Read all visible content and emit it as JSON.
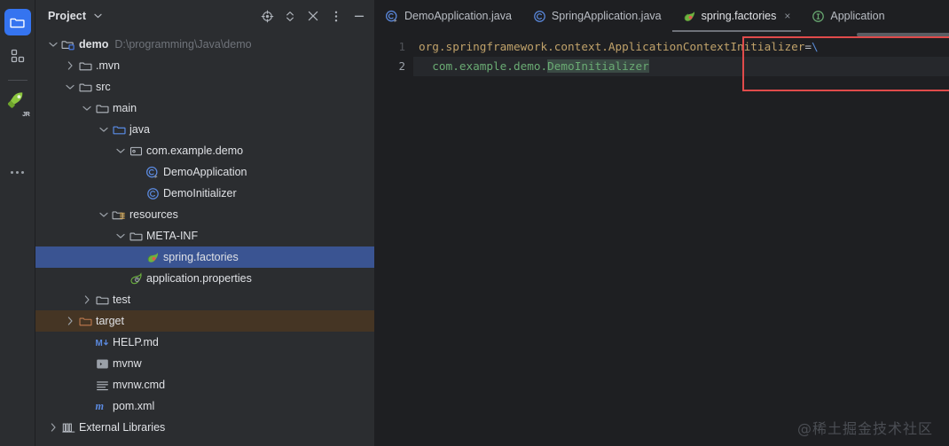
{
  "activity_bar": {
    "items": [
      {
        "name": "project-tool-window",
        "icon": "folder-icon",
        "active": true
      },
      {
        "name": "structure-tool-window",
        "icon": "grid-squares-icon",
        "active": false
      },
      {
        "name": "junie-assistant",
        "icon": "rocket-icon",
        "badge": "JR",
        "active": false
      },
      {
        "name": "more-tool-windows",
        "icon": "ellipsis-icon",
        "active": false
      }
    ]
  },
  "panel": {
    "title": "Project",
    "title_chevron": "⌄",
    "actions": [
      {
        "name": "select-opened-file-button",
        "icon": "target-icon"
      },
      {
        "name": "expand-collapse-button",
        "icon": "chevron-updown-icon"
      },
      {
        "name": "collapse-all-button",
        "icon": "collapse-x-icon"
      },
      {
        "name": "options-button",
        "icon": "vertical-dots-icon"
      },
      {
        "name": "hide-panel-button",
        "icon": "minimize-dash-icon"
      }
    ]
  },
  "tree": {
    "rows": [
      {
        "label": "demo",
        "path_hint": "D:\\programming\\Java\\demo",
        "indent": 0,
        "twisty": "down",
        "icon": "module-folder-icon",
        "bold": true,
        "state": "normal"
      },
      {
        "label": ".mvn",
        "path_hint": "",
        "indent": 1,
        "twisty": "right",
        "icon": "folder-icon",
        "bold": false,
        "state": "normal"
      },
      {
        "label": "src",
        "path_hint": "",
        "indent": 1,
        "twisty": "down",
        "icon": "folder-icon",
        "bold": false,
        "state": "normal"
      },
      {
        "label": "main",
        "path_hint": "",
        "indent": 2,
        "twisty": "down",
        "icon": "folder-icon",
        "bold": false,
        "state": "normal"
      },
      {
        "label": "java",
        "path_hint": "",
        "indent": 3,
        "twisty": "down",
        "icon": "source-folder-icon",
        "bold": false,
        "state": "normal"
      },
      {
        "label": "com.example.demo",
        "path_hint": "",
        "indent": 4,
        "twisty": "down",
        "icon": "package-icon",
        "bold": false,
        "state": "normal"
      },
      {
        "label": "DemoApplication",
        "path_hint": "",
        "indent": 5,
        "twisty": "none",
        "icon": "java-runnable-class-icon",
        "bold": false,
        "state": "normal"
      },
      {
        "label": "DemoInitializer",
        "path_hint": "",
        "indent": 5,
        "twisty": "none",
        "icon": "java-class-icon",
        "bold": false,
        "state": "normal"
      },
      {
        "label": "resources",
        "path_hint": "",
        "indent": 3,
        "twisty": "down",
        "icon": "resources-folder-icon",
        "bold": false,
        "state": "normal"
      },
      {
        "label": "META-INF",
        "path_hint": "",
        "indent": 4,
        "twisty": "down",
        "icon": "folder-icon",
        "bold": false,
        "state": "normal"
      },
      {
        "label": "spring.factories",
        "path_hint": "",
        "indent": 5,
        "twisty": "none",
        "icon": "spring-leaf-icon",
        "bold": false,
        "state": "selected"
      },
      {
        "label": "application.properties",
        "path_hint": "",
        "indent": 4,
        "twisty": "none",
        "icon": "spring-properties-icon",
        "bold": false,
        "state": "normal"
      },
      {
        "label": "test",
        "path_hint": "",
        "indent": 2,
        "twisty": "right",
        "icon": "folder-icon",
        "bold": false,
        "state": "normal"
      },
      {
        "label": "target",
        "path_hint": "",
        "indent": 1,
        "twisty": "right",
        "icon": "excluded-folder-icon",
        "bold": false,
        "state": "highlighted"
      },
      {
        "label": "HELP.md",
        "path_hint": "",
        "indent": 2,
        "twisty": "none",
        "icon": "markdown-icon",
        "bold": false,
        "state": "normal"
      },
      {
        "label": "mvnw",
        "path_hint": "",
        "indent": 2,
        "twisty": "none",
        "icon": "shell-script-icon",
        "bold": false,
        "state": "normal"
      },
      {
        "label": "mvnw.cmd",
        "path_hint": "",
        "indent": 2,
        "twisty": "none",
        "icon": "text-lines-icon",
        "bold": false,
        "state": "normal"
      },
      {
        "label": "pom.xml",
        "path_hint": "",
        "indent": 2,
        "twisty": "none",
        "icon": "maven-icon",
        "bold": false,
        "state": "normal"
      },
      {
        "label": "External Libraries",
        "path_hint": "",
        "indent": 0,
        "twisty": "right",
        "icon": "library-icon",
        "bold": false,
        "state": "normal"
      }
    ]
  },
  "editor": {
    "tabs": [
      {
        "label": "DemoApplication.java",
        "icon": "java-runnable-class-icon",
        "active": false,
        "closable": false
      },
      {
        "label": "SpringApplication.java",
        "icon": "java-class-icon",
        "active": false,
        "closable": false
      },
      {
        "label": "spring.factories",
        "icon": "spring-leaf-icon",
        "active": true,
        "closable": true,
        "close_glyph": "×"
      },
      {
        "label": "Application",
        "icon": "interface-icon",
        "active": false,
        "closable": false
      }
    ],
    "gutter_numbers": [
      "1",
      "2"
    ],
    "code": {
      "line1": {
        "key": "org.springframework.context.ApplicationContextInitializer",
        "equals": "=",
        "continuation": "\\"
      },
      "line2": {
        "indent": "  ",
        "prefix": "com.example.demo.",
        "highlighted": "DemoInitializer"
      }
    }
  },
  "watermark": "@稀土掘金技术社区",
  "colors": {
    "editor_bg": "#1e1f22",
    "panel_bg": "#2b2d30",
    "selection_blue": "#3a5492",
    "excluded_brown": "#453524",
    "annotation_red": "#e04b4b",
    "key_tan": "#c0a26a",
    "value_green": "#6aab73",
    "accent_blue": "#3574f0"
  }
}
